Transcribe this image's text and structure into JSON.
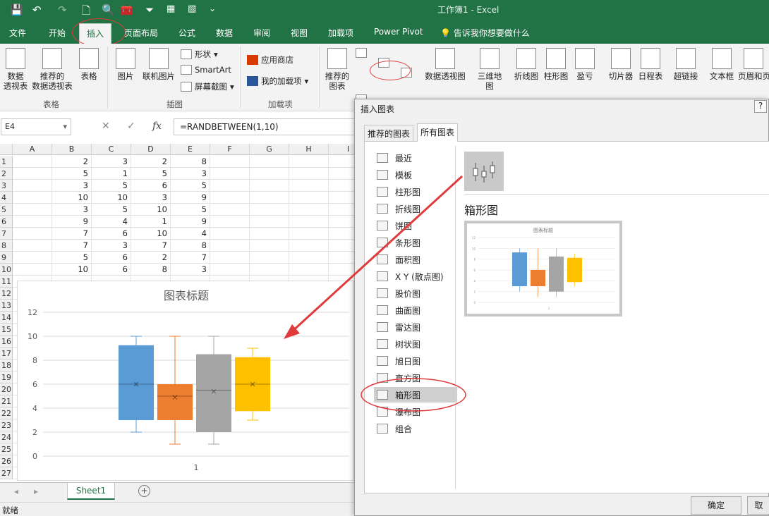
{
  "titlebar": {
    "title": "工作簿1 - Excel",
    "save": "💾",
    "undo": "↶",
    "redo": "↷",
    "new": "🗋",
    "preview": "🔍",
    "toolbox": "🧰",
    "filter": "⏷",
    "more": "⌄"
  },
  "tabs": [
    {
      "label": "文件",
      "active": false
    },
    {
      "label": "开始",
      "active": false
    },
    {
      "label": "插入",
      "active": true
    },
    {
      "label": "页面布局",
      "active": false
    },
    {
      "label": "公式",
      "active": false
    },
    {
      "label": "数据",
      "active": false
    },
    {
      "label": "审阅",
      "active": false
    },
    {
      "label": "视图",
      "active": false
    },
    {
      "label": "加载项",
      "active": false
    },
    {
      "label": "Power Pivot",
      "active": false
    }
  ],
  "tellme": "💡 告诉我你想要做什么",
  "ribbon": {
    "pivot1": "数据\n透视表",
    "pivot2": "推荐的\n数据透视表",
    "table": "表格",
    "picture": "图片",
    "online_picture": "联机图片",
    "shapes": "形状",
    "smartart": "SmartArt",
    "screenshot": "屏幕截图",
    "store": "应用商店",
    "my_addins": "我的加载项",
    "rec_charts": "推荐的\n图表",
    "pivotchart": "数据透视图",
    "map3d": "三维地\n图",
    "spark_line": "折线图",
    "spark_column": "柱形图",
    "spark_winloss": "盈亏",
    "slicer": "切片器",
    "timeline": "日程表",
    "hyperlink": "超链接",
    "textbox": "文本框",
    "headerfooter": "页眉和页",
    "groups": {
      "tables": "表格",
      "illustrations": "插图",
      "addins": "加载项"
    }
  },
  "formula_bar": {
    "name_box": "E4",
    "cancel": "✕",
    "enter": "✓",
    "fx": "fx",
    "formula": "=RANDBETWEEN(1,10)"
  },
  "sheet": {
    "columns": [
      "A",
      "B",
      "C",
      "D",
      "E",
      "F",
      "G",
      "H",
      "I"
    ],
    "row_numbers": [
      "1",
      "2",
      "3",
      "4",
      "5",
      "6",
      "7",
      "8",
      "9",
      "10",
      "11",
      "12",
      "13",
      "14",
      "15",
      "16",
      "17",
      "18",
      "19",
      "20",
      "21",
      "22",
      "23",
      "24",
      "25",
      "26",
      "27"
    ],
    "data": [
      [
        "2",
        "3",
        "2",
        "8"
      ],
      [
        "5",
        "1",
        "5",
        "3"
      ],
      [
        "3",
        "5",
        "6",
        "5"
      ],
      [
        "10",
        "10",
        "3",
        "9"
      ],
      [
        "3",
        "5",
        "10",
        "5"
      ],
      [
        "9",
        "4",
        "1",
        "9"
      ],
      [
        "7",
        "6",
        "10",
        "4"
      ],
      [
        "7",
        "3",
        "7",
        "8"
      ],
      [
        "5",
        "6",
        "2",
        "7"
      ],
      [
        "10",
        "6",
        "8",
        "3"
      ]
    ]
  },
  "chart_data": {
    "type": "box",
    "title": "图表标题",
    "x_tick": "1",
    "y_ticks": [
      "0",
      "2",
      "4",
      "6",
      "8",
      "10",
      "12"
    ],
    "ylim": [
      0,
      12
    ],
    "series": [
      {
        "color": "#5b9bd5",
        "min": 2,
        "q1": 3,
        "median": 6,
        "q3": 9.25,
        "max": 10,
        "mean": 6
      },
      {
        "color": "#ed7d31",
        "min": 1,
        "q1": 3,
        "median": 5,
        "q3": 6,
        "max": 10,
        "mean": 4.9
      },
      {
        "color": "#a5a5a5",
        "min": 1,
        "q1": 2,
        "median": 5.5,
        "q3": 8.5,
        "max": 10,
        "mean": 5.4
      },
      {
        "color": "#ffc000",
        "min": 3,
        "q1": 3.75,
        "median": 6,
        "q3": 8.25,
        "max": 9,
        "mean": 6
      }
    ]
  },
  "sheet_tab": "Sheet1",
  "status": "就绪",
  "dialog": {
    "title": "插入图表",
    "help": "?",
    "tab_recommended": "推荐的图表",
    "tab_all": "所有图表",
    "chart_types": [
      "最近",
      "模板",
      "柱形图",
      "折线图",
      "饼图",
      "条形图",
      "面积图",
      "X Y (散点图)",
      "股价图",
      "曲面图",
      "雷达图",
      "树状图",
      "旭日图",
      "直方图",
      "箱形图",
      "瀑布图",
      "组合"
    ],
    "selected_type": "箱形图",
    "preview_heading": "箱形图",
    "preview_title": "图表标题",
    "preview_x_tick": "1",
    "ok": "确定",
    "cancel": "取"
  },
  "colors": {
    "excel_green": "#217346",
    "annotation_red": "#e03a3a"
  }
}
